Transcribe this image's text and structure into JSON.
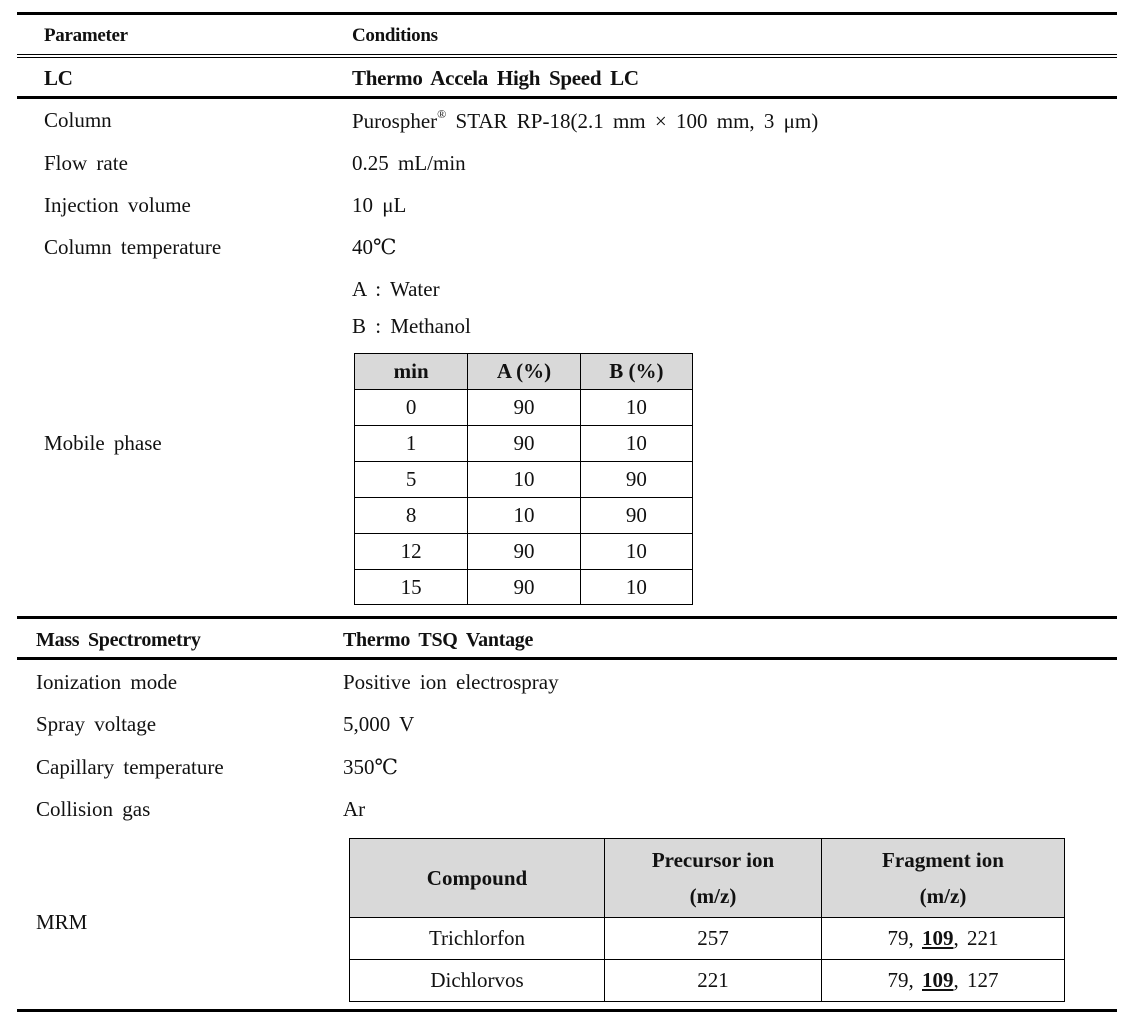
{
  "header": {
    "parameter": "Parameter",
    "conditions": "Conditions"
  },
  "lc": {
    "section_label": "LC",
    "instrument": "Thermo Accela High Speed LC",
    "rows": [
      {
        "param": "Column",
        "value_prefix": "Purospher",
        "value_sup": "®",
        "value_suffix": " STAR RP-18(2.1 mm × 100 mm, 3 μm)"
      },
      {
        "param": "Flow rate",
        "value": "0.25 mL/min"
      },
      {
        "param": "Injection volume",
        "value": "10 μL"
      },
      {
        "param": "Column temperature",
        "value": "40℃"
      }
    ],
    "mobile_phase": {
      "param": "Mobile phase",
      "solvent_a": "A : Water",
      "solvent_b": "B : Methanol",
      "gradient": {
        "columns": [
          "min",
          "A (%)",
          "B (%)"
        ],
        "rows": [
          [
            "0",
            "90",
            "10"
          ],
          [
            "1",
            "90",
            "10"
          ],
          [
            "5",
            "10",
            "90"
          ],
          [
            "8",
            "10",
            "90"
          ],
          [
            "12",
            "90",
            "10"
          ],
          [
            "15",
            "90",
            "10"
          ]
        ]
      }
    }
  },
  "ms": {
    "section_label": "Mass Spectrometry",
    "instrument": "Thermo TSQ Vantage",
    "rows": [
      {
        "param": "Ionization mode",
        "value": "Positive ion electrospray"
      },
      {
        "param": "Spray voltage",
        "value": "5,000 V"
      },
      {
        "param": "Capillary temperature",
        "value": "350℃"
      },
      {
        "param": "Collision gas",
        "value": "Ar"
      }
    ],
    "mrm": {
      "param": "MRM",
      "columns": {
        "compound": "Compound",
        "precursor_line1": "Precursor ion",
        "precursor_line2": "(m/z)",
        "fragment_line1": "Fragment ion",
        "fragment_line2": "(m/z)"
      },
      "rows": [
        {
          "compound": "Trichlorfon",
          "precursor": "257",
          "frag_a": "79, ",
          "frag_quant": "109",
          "frag_b": ", 221"
        },
        {
          "compound": "Dichlorvos",
          "precursor": "221",
          "frag_a": "79, ",
          "frag_quant": "109",
          "frag_b": ", 127"
        }
      ]
    }
  }
}
